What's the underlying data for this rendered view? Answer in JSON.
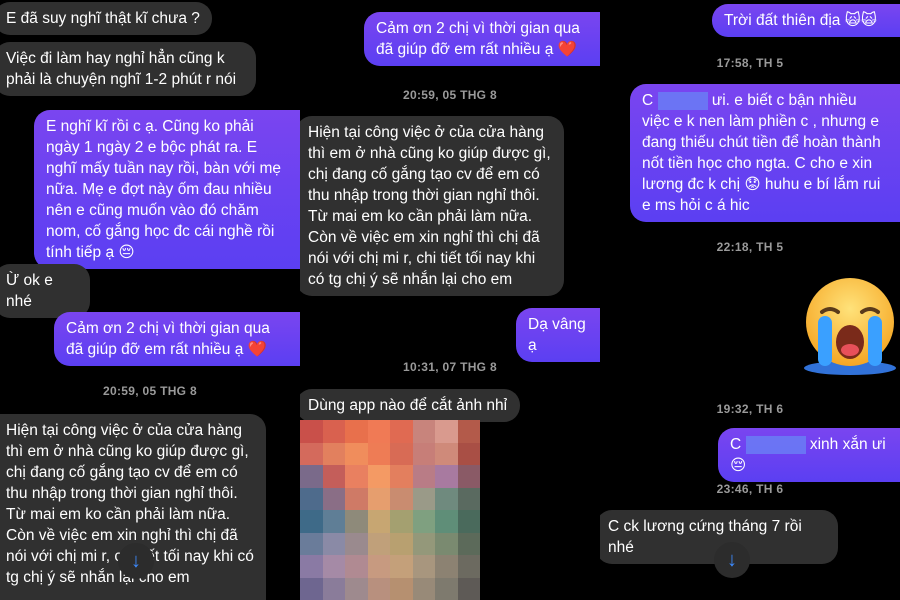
{
  "panel1": {
    "msg1": "E đã suy nghĩ thật kĩ chưa ?",
    "msg2": "Việc đi làm hay nghỉ hẳn cũng k phải là chuyện nghĩ 1-2 phút r nói",
    "msg3": "E nghĩ kĩ rồi c ạ. Cũng ko phải ngày 1 ngày 2 e bộc phát ra. E nghĩ mấy tuần nay rồi, bàn với mẹ nữa. Mẹ e đợt này ốm đau nhiều nên e cũng muốn vào đó chăm nom, cố gắng học đc cái nghề rồi tính tiếp ạ 😔",
    "msg4": "Ừ ok e nhé",
    "msg5": "Cảm ơn 2 chị vì thời gian qua đã giúp đỡ em rất nhiều ạ",
    "heart": "❤️",
    "stamp1": "20:59, 05 THG 8",
    "msg6": "Hiện tại công việc ở của cửa hàng thì em ở nhà cũng ko giúp được gì, chị đang cố gắng tạo cv để em có thu nhập trong thời gian nghỉ thôi. Từ mai em ko cần phải làm nữa. Còn về việc em xin nghỉ thì chị đã nói với chị mi r, chi tiết tối nay khi có tg chị ý sẽ nhắn lại cho em",
    "scroll_icon": "↓"
  },
  "panel2": {
    "msg1": "Cảm ơn 2 chị vì thời gian qua đã giúp đỡ em rất nhiều ạ",
    "heart": "❤️",
    "stamp1": "20:59, 05 THG 8",
    "msg2": "Hiện tại công việc ở của cửa hàng thì em ở nhà cũng ko giúp được gì, chị đang cố gắng tạo cv để em có thu nhập trong thời gian nghỉ thôi. Từ mai em ko cần phải làm nữa. Còn về việc em xin nghỉ thì chị đã nói với chị mi r, chi tiết tối nay khi có tg chị ý sẽ nhắn lại cho em",
    "msg3": "Dạ vâng ạ",
    "stamp2": "10:31, 07 THG 8",
    "msg4": "Dùng app nào để cắt ảnh nhỉ",
    "pixel_colors": [
      "#c9504a",
      "#d9614f",
      "#e8704c",
      "#f07a55",
      "#e06a52",
      "#c8847c",
      "#d99a8e",
      "#b35a4a",
      "#d46a5c",
      "#e2805e",
      "#f08d5c",
      "#ee7c55",
      "#d86b55",
      "#c77e78",
      "#cf8a7a",
      "#a94f45",
      "#7a6a8a",
      "#c45e5a",
      "#e98060",
      "#f49a64",
      "#e37f5e",
      "#b97c86",
      "#a87aa0",
      "#8a5a66",
      "#4e6b8c",
      "#8a6e86",
      "#cf7a66",
      "#e69e6e",
      "#c98c70",
      "#9a9a88",
      "#6f8a7e",
      "#5a6a60",
      "#3e6a88",
      "#5f7e96",
      "#8e8a7a",
      "#c7a672",
      "#a4a070",
      "#7fa080",
      "#5f8e78",
      "#4a6a5c",
      "#6a7c9a",
      "#8a8aa6",
      "#9a8a8e",
      "#c0a07a",
      "#b8a070",
      "#94987a",
      "#7a8a70",
      "#5c6a5a",
      "#8a7aa4",
      "#a58aa6",
      "#b08a92",
      "#c79a80",
      "#c4a07a",
      "#a8967e",
      "#8c8272",
      "#6c6a60",
      "#6e6690",
      "#8a7c9a",
      "#9e8a8e",
      "#b8907e",
      "#b69070",
      "#988a78",
      "#7e7a6e",
      "#5e5a56"
    ]
  },
  "panel3": {
    "msg1": "Trời đất thiên địa 🙀🙀",
    "stamp1": "17:58, TH 5",
    "msg2a": "C",
    "msg2b": "ưi. e biết c bận nhiều việc e k nen làm phiền c , nhưng e đang thiếu chút tiền để hoàn thành nốt tiền học cho ngta. C cho e xin lương đc k chị 😟 huhu e bí lắm rui e ms hỏi c á hic",
    "stamp2": "22:18, TH 5",
    "emoji_big": "😭",
    "stamp3": "19:32, TH 6",
    "msg3a": "C",
    "msg3b": "xinh xắn ưi 😔",
    "stamp4": "23:46, TH 6",
    "msg4": "C ck lương cứng tháng 7 rồi nhé",
    "scroll_icon": "↓"
  }
}
